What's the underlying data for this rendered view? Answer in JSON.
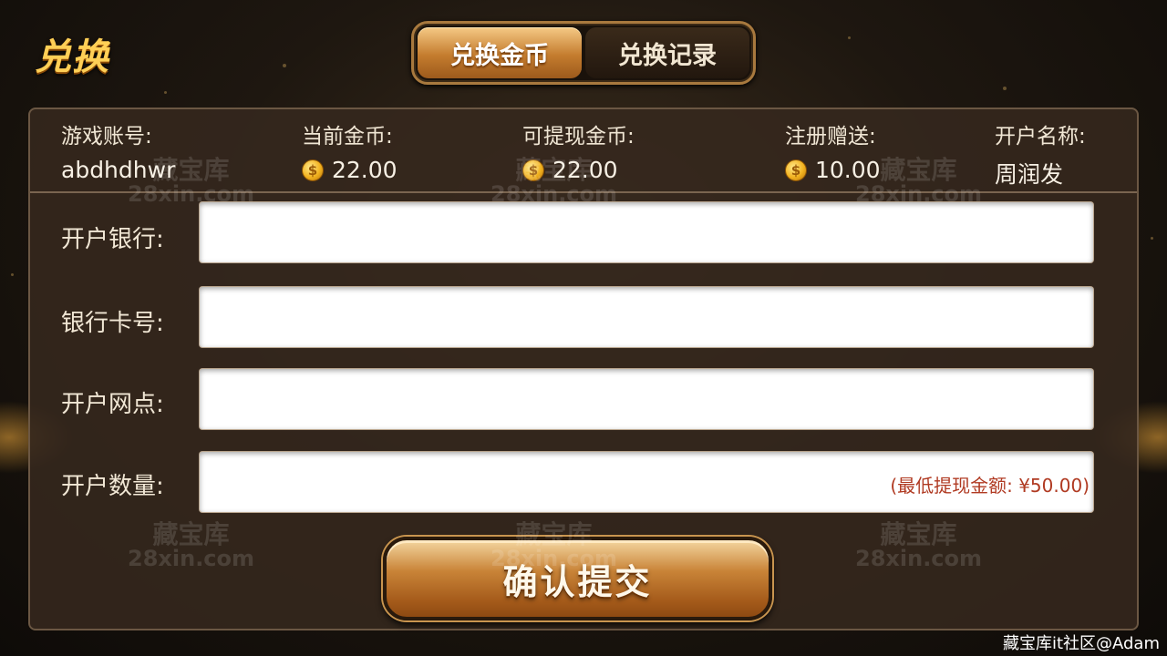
{
  "header": {
    "title": "兑换"
  },
  "tabs": [
    {
      "label": "兑换金币",
      "active": true
    },
    {
      "label": "兑换记录",
      "active": false
    }
  ],
  "account_info": {
    "game_account": {
      "label": "游戏账号:",
      "value": "abdhdhwr"
    },
    "current_coins": {
      "label": "当前金币:",
      "value": "22.00",
      "icon": "coin-icon"
    },
    "withdrawable_coins": {
      "label": "可提现金币:",
      "value": "22.00",
      "icon": "coin-icon"
    },
    "register_bonus": {
      "label": "注册赠送:",
      "value": "10.00",
      "icon": "coin-icon"
    },
    "account_name": {
      "label": "开户名称:",
      "value": "周润发"
    }
  },
  "form": {
    "bank": {
      "label": "开户银行:",
      "value": "",
      "placeholder": ""
    },
    "card_number": {
      "label": "银行卡号:",
      "value": "",
      "placeholder": ""
    },
    "branch": {
      "label": "开户网点:",
      "value": "",
      "placeholder": ""
    },
    "amount": {
      "label": "开户数量:",
      "value": "",
      "hint": "(最低提现金额: ¥50.00)"
    }
  },
  "submit_label": "确认提交",
  "watermark": {
    "line1": "藏宝库",
    "line2": "28xin.com"
  },
  "footer_note": "藏宝库it社区@Adam",
  "colors": {
    "accent": "#c98438",
    "title": "#ffcf56",
    "hint": "#b03a22",
    "panel": "#36281e"
  }
}
